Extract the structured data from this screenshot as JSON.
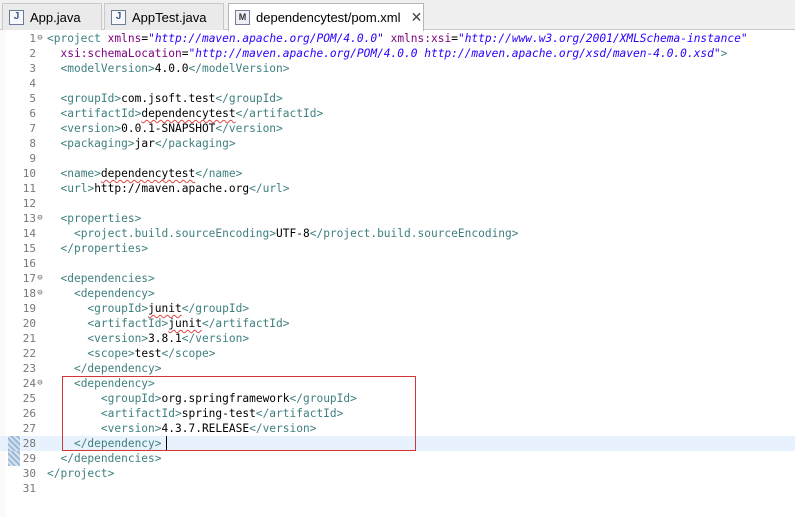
{
  "tabs": [
    {
      "label": "App.java",
      "icon": "java-file-icon",
      "active": false
    },
    {
      "label": "AppTest.java",
      "icon": "java-file-icon",
      "active": false
    },
    {
      "label": "dependencytest/pom.xml",
      "icon": "xml-file-icon",
      "active": true,
      "close": "✕"
    }
  ],
  "editor": {
    "line_numbers": [
      "1",
      "2",
      "3",
      "4",
      "5",
      "6",
      "7",
      "8",
      "9",
      "10",
      "11",
      "12",
      "13",
      "14",
      "15",
      "16",
      "17",
      "18",
      "19",
      "20",
      "21",
      "22",
      "23",
      "24",
      "25",
      "26",
      "27",
      "28",
      "29",
      "30",
      "31"
    ],
    "current_line": 28,
    "foldable_lines": [
      1,
      13,
      17,
      18,
      24
    ],
    "colors": {
      "tag": "#3f7f7f",
      "attribute": "#7f007f",
      "string": "#2a00ff",
      "text": "#000000",
      "current_line": "#e8f2fe",
      "highlight_box": "#d23636"
    },
    "lines": [
      "<project xmlns=\"http://maven.apache.org/POM/4.0.0\" xmlns:xsi=\"http://www.w3.org/2001/XMLSchema-instance\"",
      "  xsi:schemaLocation=\"http://maven.apache.org/POM/4.0.0 http://maven.apache.org/xsd/maven-4.0.0.xsd\">",
      "  <modelVersion>4.0.0</modelVersion>",
      "",
      "  <groupId>com.jsoft.test</groupId>",
      "  <artifactId>dependencytest</artifactId>",
      "  <version>0.0.1-SNAPSHOT</version>",
      "  <packaging>jar</packaging>",
      "",
      "  <name>dependencytest</name>",
      "  <url>http://maven.apache.org</url>",
      "",
      "  <properties>",
      "    <project.build.sourceEncoding>UTF-8</project.build.sourceEncoding>",
      "  </properties>",
      "",
      "  <dependencies>",
      "    <dependency>",
      "      <groupId>junit</groupId>",
      "      <artifactId>junit</artifactId>",
      "      <version>3.8.1</version>",
      "      <scope>test</scope>",
      "    </dependency>",
      "    <dependency>",
      "        <groupId>org.springframework</groupId>",
      "        <artifactId>spring-test</artifactId>",
      "        <version>4.3.7.RELEASE</version>",
      "    </dependency>",
      "  </dependencies>",
      "</project>",
      ""
    ]
  }
}
